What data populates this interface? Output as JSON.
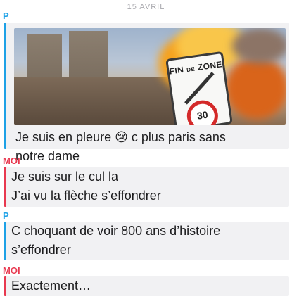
{
  "date_header": "15 AVRIL",
  "messages": [
    {
      "sender": "P",
      "text_lines": [
        "Je suis en pleure 😢 c plus paris sans",
        "notre dame"
      ],
      "photo": {
        "sign_lines": [
          "FIN",
          "DE",
          "ZONE"
        ],
        "speed_limit": "30"
      }
    },
    {
      "sender": "MOI",
      "text_lines": [
        "Je suis sur le cul la",
        "J’ai vu la flèche s’effondrer"
      ]
    },
    {
      "sender": "P",
      "text_lines": [
        "C choquant de voir 800 ans d’histoire",
        "s’effondrer"
      ]
    },
    {
      "sender": "MOI",
      "text_lines": [
        "Exactement…"
      ]
    }
  ],
  "colors": {
    "p_accent": "#1da1e6",
    "moi_accent": "#e8384f",
    "bubble_bg": "#f1f1f3"
  }
}
